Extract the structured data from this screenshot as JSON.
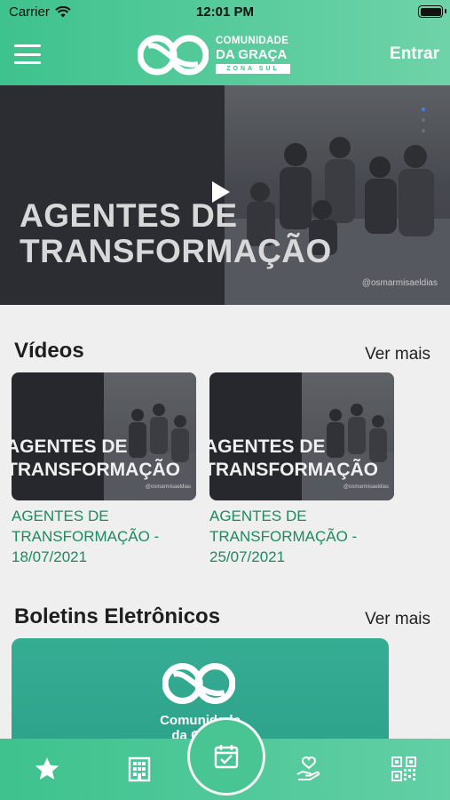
{
  "status_bar": {
    "carrier": "Carrier",
    "time": "12:01 PM"
  },
  "header": {
    "logo": {
      "line1": "COMUNIDADE",
      "line2": "DA GRAÇA",
      "line3": "ZONA SUL"
    },
    "login_label": "Entrar"
  },
  "hero": {
    "title_line1": "AGENTES DE",
    "title_line2": "TRANSFORMAÇÃO",
    "handle": "@osmarmisaeldias"
  },
  "videos": {
    "title": "Vídeos",
    "see_more": "Ver mais",
    "items": [
      {
        "thumb_line1": "AGENTES DE",
        "thumb_line2": "TRANSFORMAÇÃO",
        "thumb_handle": "@osmarmisaeldias",
        "caption": "AGENTES DE TRANSFORMAÇÃO - 18/07/2021"
      },
      {
        "thumb_line1": "AGENTES DE",
        "thumb_line2": "TRANSFORMAÇÃO",
        "thumb_handle": "@osmarmisaeldias",
        "caption": "AGENTES DE TRANSFORMAÇÃO - 25/07/2021"
      }
    ]
  },
  "bulletins": {
    "title": "Boletins Eletrônicos",
    "see_more": "Ver mais",
    "card": {
      "line1": "Comunidade",
      "line2": "da Graça"
    }
  },
  "tabbar": {
    "icons": [
      "star-icon",
      "building-icon",
      "calendar-check-icon",
      "heart-hand-icon",
      "qr-code-icon"
    ],
    "active": "calendar-check-icon"
  },
  "colors": {
    "brand_green": "#3ec28e",
    "accent_text": "#1e8a5f",
    "bulletin_teal": "#2da18a"
  }
}
